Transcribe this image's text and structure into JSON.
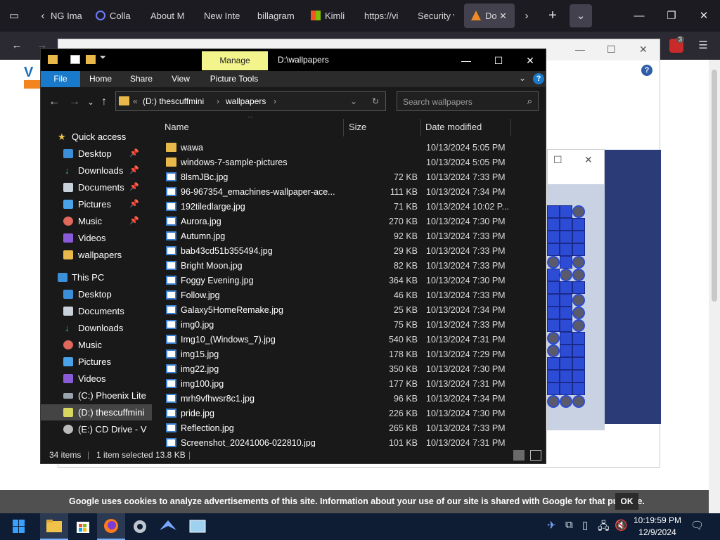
{
  "browser": {
    "tabs": [
      {
        "label": "NG Ima"
      },
      {
        "label": "Colla"
      },
      {
        "label": "About M"
      },
      {
        "label": "New Inte"
      },
      {
        "label": "billagram"
      },
      {
        "label": "Kimli"
      },
      {
        "label": "https://vi"
      },
      {
        "label": "Security v"
      },
      {
        "label": "Do"
      }
    ],
    "badge_count": "3"
  },
  "explorer": {
    "title": "D:\\wallpapers",
    "manage_tab": "Manage",
    "ribbon_tabs": [
      "File",
      "Home",
      "Share",
      "View",
      "Picture Tools"
    ],
    "address": {
      "prefix": "«",
      "drive": "(D:) thescuffmini",
      "folder": "wallpapers"
    },
    "search_placeholder": "Search wallpapers",
    "nav": {
      "quick_access": "Quick access",
      "quick_items": [
        "Desktop",
        "Downloads",
        "Documents",
        "Pictures",
        "Music",
        "Videos",
        "wallpapers"
      ],
      "this_pc": "This PC",
      "pc_items": [
        "Desktop",
        "Documents",
        "Downloads",
        "Music",
        "Pictures",
        "Videos",
        "(C:) Phoenix Lite",
        "(D:) thescuffmini",
        "(E:) CD Drive - V"
      ]
    },
    "columns": {
      "name": "Name",
      "size": "Size",
      "date": "Date modified"
    },
    "files": [
      {
        "name": "wawa",
        "size": "",
        "date": "10/13/2024 5:05 PM",
        "type": "folder"
      },
      {
        "name": "windows-7-sample-pictures",
        "size": "",
        "date": "10/13/2024 5:05 PM",
        "type": "folder"
      },
      {
        "name": "8lsmJBc.jpg",
        "size": "72 KB",
        "date": "10/13/2024 7:33 PM",
        "type": "image"
      },
      {
        "name": "96-967354_emachines-wallpaper-ace...",
        "size": "111 KB",
        "date": "10/13/2024 7:34 PM",
        "type": "image"
      },
      {
        "name": "192tiledlarge.jpg",
        "size": "71 KB",
        "date": "10/13/2024 10:02 P...",
        "type": "image"
      },
      {
        "name": "Aurora.jpg",
        "size": "270 KB",
        "date": "10/13/2024 7:30 PM",
        "type": "image"
      },
      {
        "name": "Autumn.jpg",
        "size": "92 KB",
        "date": "10/13/2024 7:33 PM",
        "type": "image"
      },
      {
        "name": "bab43cd51b355494.jpg",
        "size": "29 KB",
        "date": "10/13/2024 7:33 PM",
        "type": "image"
      },
      {
        "name": "Bright Moon.jpg",
        "size": "82 KB",
        "date": "10/13/2024 7:33 PM",
        "type": "image"
      },
      {
        "name": "Foggy Evening.jpg",
        "size": "364 KB",
        "date": "10/13/2024 7:30 PM",
        "type": "image"
      },
      {
        "name": "Follow.jpg",
        "size": "46 KB",
        "date": "10/13/2024 7:33 PM",
        "type": "image"
      },
      {
        "name": "Galaxy5HomeRemake.jpg",
        "size": "25 KB",
        "date": "10/13/2024 7:34 PM",
        "type": "image"
      },
      {
        "name": "img0.jpg",
        "size": "75 KB",
        "date": "10/13/2024 7:33 PM",
        "type": "image"
      },
      {
        "name": "Img10_(Windows_7).jpg",
        "size": "540 KB",
        "date": "10/13/2024 7:31 PM",
        "type": "image"
      },
      {
        "name": "img15.jpg",
        "size": "178 KB",
        "date": "10/13/2024 7:29 PM",
        "type": "image"
      },
      {
        "name": "img22.jpg",
        "size": "350 KB",
        "date": "10/13/2024 7:30 PM",
        "type": "image"
      },
      {
        "name": "img100.jpg",
        "size": "177 KB",
        "date": "10/13/2024 7:31 PM",
        "type": "image"
      },
      {
        "name": "mrh9vfhwsr8c1.jpg",
        "size": "96 KB",
        "date": "10/13/2024 7:34 PM",
        "type": "image"
      },
      {
        "name": "pride.jpg",
        "size": "226 KB",
        "date": "10/13/2024 7:30 PM",
        "type": "image"
      },
      {
        "name": "Reflection.jpg",
        "size": "265 KB",
        "date": "10/13/2024 7:33 PM",
        "type": "image"
      },
      {
        "name": "Screenshot_20241006-022810.jpg",
        "size": "101 KB",
        "date": "10/13/2024 7:31 PM",
        "type": "image"
      }
    ],
    "status": {
      "items": "34 items",
      "selected": "1 item selected",
      "size": "13.8 KB"
    }
  },
  "cookie": {
    "text": "Google uses cookies to analyze advertisements of this site. Information about your use of our site is shared with Google for that purpose.",
    "ok": "OK"
  },
  "taskbar": {
    "time": "10:19:59 PM",
    "date": "12/9/2024"
  },
  "colors": {
    "accent": "#1979ca",
    "manage": "#f4f48c",
    "explorer_bg": "#191919"
  }
}
